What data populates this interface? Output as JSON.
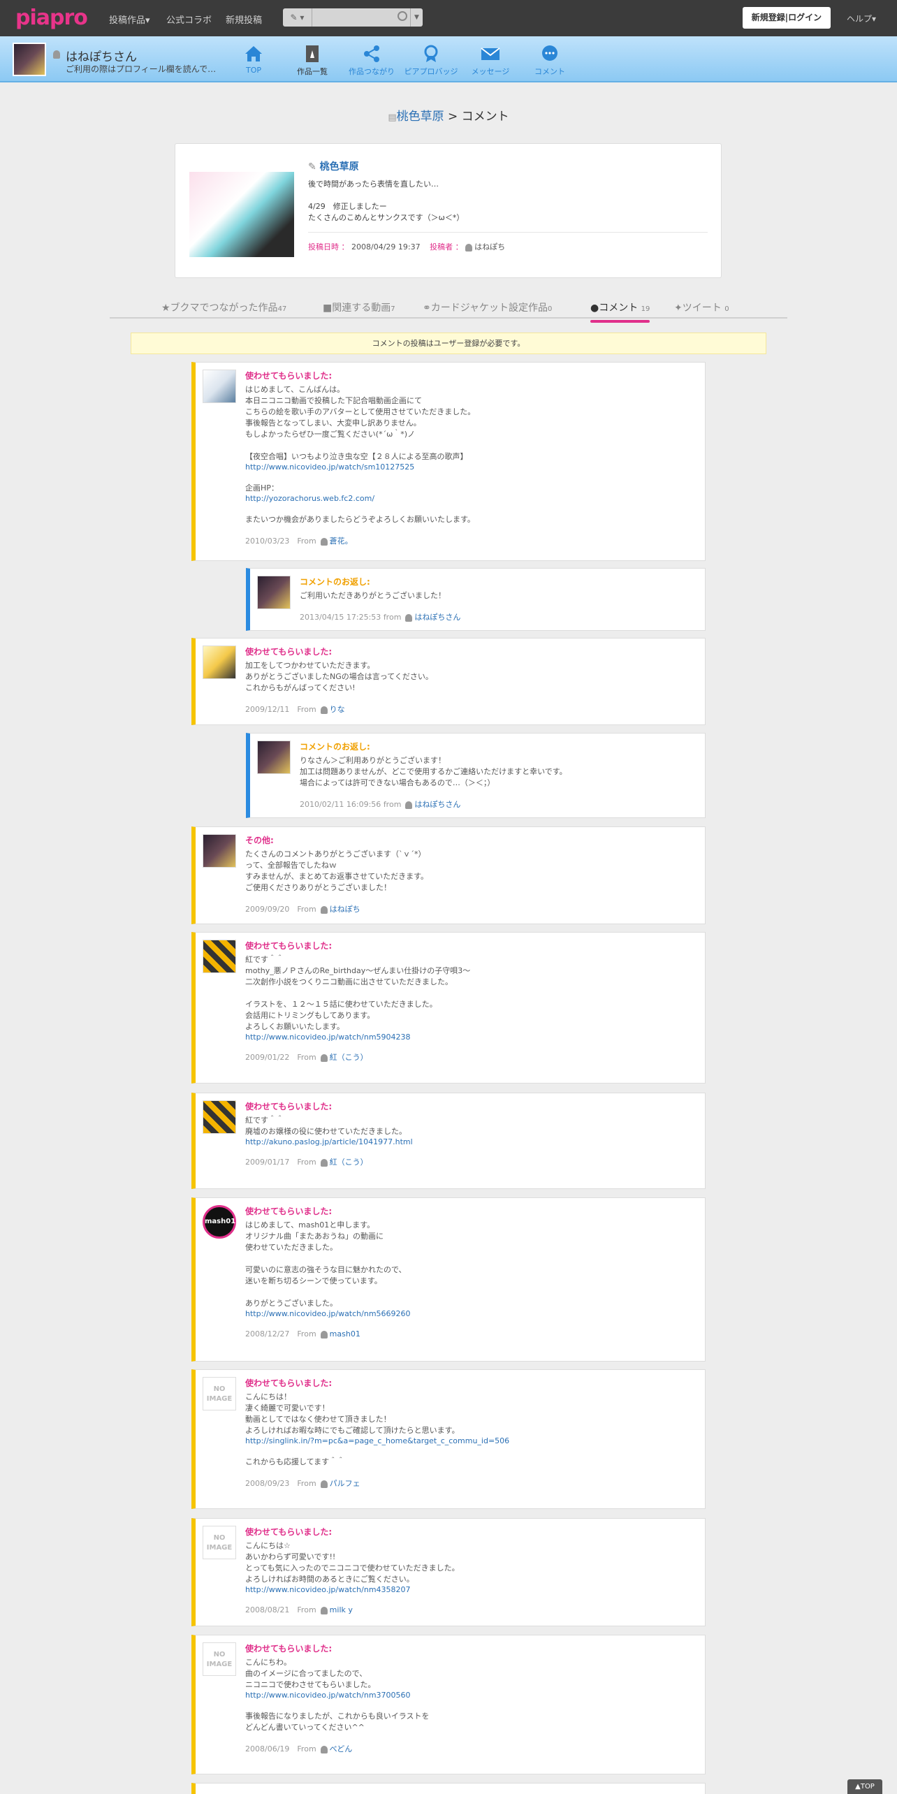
{
  "header": {
    "logo": "piapro",
    "nav": [
      "投稿作品▾",
      "公式コラボ",
      "新規投稿"
    ],
    "search": {
      "type": "✎ ▾",
      "placeholder": ""
    },
    "login": "新規登録|ログイン",
    "help": "ヘルプ▾"
  },
  "userbar": {
    "name": "はねぽちさん",
    "note": "ご利用の際はプロフィール欄を読んで…",
    "items": [
      {
        "label": "TOP",
        "icon": "home-icon"
      },
      {
        "label": "作品一覧",
        "icon": "works-icon"
      },
      {
        "label": "作品つながり",
        "icon": "share-icon"
      },
      {
        "label": "ピアプロバッジ",
        "icon": "badge-icon"
      },
      {
        "label": "メッセージ",
        "icon": "mail-icon"
      },
      {
        "label": "コメント",
        "icon": "comment-icon"
      }
    ]
  },
  "breadcrumb": {
    "work": "桃色草原",
    "sep": ">",
    "page": "コメント"
  },
  "work": {
    "title": "桃色草原",
    "desc": "後で時間があったら表情を直したい…\n\n4/29　修正しましたー\nたくさんのこめんとサンクスです（＞ω＜*）",
    "date_label": "投稿日時",
    "date": "2008/04/29 19:37",
    "author_label": "投稿者",
    "author": "はねぽち"
  },
  "tabs": [
    {
      "label": "ブクマでつながった作品",
      "count": "47"
    },
    {
      "label": "関連する動画",
      "count": "7"
    },
    {
      "label": "カードジャケット設定作品",
      "count": "0"
    },
    {
      "label": "コメント",
      "count": "19"
    },
    {
      "label": "ツイート",
      "count": "0"
    }
  ],
  "notice": "コメントの投稿はユーザー登録が必要です。",
  "comments": [
    {
      "title": "使わせてもらいました:",
      "text": "はじめまして、こんばんは。\n本日ニコニコ動画で投稿した下記合唱動画企画にて\nこちらの絵を歌い手のアバターとして使用させていただきました。\n事後報告となってしまい、大変申し訳ありません。\nもしよかったらぜひ一度ご覧ください(*´ω｀*)ノ\n\n【夜空合唱】いつもより泣き虫な空【２８人による至高の歌声】",
      "link": "http://www.nicovideo.jp/watch/sm10127525",
      "text2": "\n企画HP：",
      "link2": "http://yozorachorus.web.fc2.com/",
      "text3": "\nまたいつか機会がありましたらどうぞよろしくお願いいたします。",
      "date": "2010/03/23",
      "from": "From",
      "user": "蒼花。"
    },
    {
      "title": "コメントのお返し:",
      "text": "ご利用いただきありがとうございました！",
      "date": "2013/04/15 17:25:53",
      "from": "from",
      "user": "はねぽちさん"
    },
    {
      "title": "使わせてもらいました:",
      "text": "加工をしてつかわせていただきます。\nありがとうございましたNGの場合は言ってください。\nこれからもがんばってください!",
      "date": "2009/12/11",
      "from": "From",
      "user": "りな"
    },
    {
      "title": "コメントのお返し:",
      "text": "りなさん＞ご利用ありがとうございます！\n加工は問題ありませんが、どこで使用するかご連絡いただけますと幸いです。\n場合によっては許可できない場合もあるので…（＞＜；）",
      "date": "2010/02/11 16:09:56",
      "from": "from",
      "user": "はねぽちさん"
    },
    {
      "title": "その他:",
      "text": "たくさんのコメントありがとうございます（`ｖ´*）\nって、全部報告でしたねｗ\nすみませんが、まとめてお返事させていただきます。\nご使用くださりありがとうございました！",
      "date": "2009/09/20",
      "from": "From",
      "user": "はねぽち"
    },
    {
      "title": "使わせてもらいました:",
      "text": "紅です＾＾\nmothy_悪ノＰさんのRe_birthday～ぜんまい仕掛けの子守唄3～\n二次創作小説をつくりニコ動画に出させていただきました。\n\nイラストを、１２～１５話に使わせていただきました。\n会話用にトリミングもしてあります。\nよろしくお願いいたします。\n",
      "link": "http://www.nicovideo.jp/watch/nm5904238",
      "date": "2009/01/22",
      "from": "From",
      "user": "紅（こう）"
    },
    {
      "title": "使わせてもらいました:",
      "text": "紅です＾＾\n廃墟のお嬢様の役に使わせていただきました。\n",
      "link": "http://akuno.paslog.jp/article/1041977.html",
      "date": "2009/01/17",
      "from": "From",
      "user": "紅（こう）"
    },
    {
      "title": "使わせてもらいました:",
      "text": "はじめまして、mash01と申します。\nオリジナル曲「またあおうね」の動画に\n使わせていただきました。\n\n可愛いのに意志の強そうな目に魅かれたので、\n迷いを断ち切るシーンで使っています。\n\nありがとうございました。\n",
      "link": "http://www.nicovideo.jp/watch/nm5669260",
      "date": "2008/12/27",
      "from": "From",
      "user": "mash01",
      "avatar_text": "mash01"
    },
    {
      "title": "使わせてもらいました:",
      "text": "こんにちは！\n凄く綺麗で可愛いです！\n動画としてではなく使わせて頂きました！\nよろしければお暇な時にでもご確認して頂けたらと思います。\n",
      "link": "http://singlink.in/?m=pc&a=page_c_home&target_c_commu_id=506",
      "text2": "\nこれからも応援してます＾＾",
      "date": "2008/09/23",
      "from": "From",
      "user": "パルフェ",
      "noimg": "NO IMAGE"
    },
    {
      "title": "使わせてもらいました:",
      "text": "こんにちは☆\nあいかわらず可愛いです!!\nとっても気に入ったのでニコニコで使わせていただきました。\nよろしければお時間のあるときにご覧ください。",
      "link": "http://www.nicovideo.jp/watch/nm4358207",
      "date": "2008/08/21",
      "from": "From",
      "user": "milk y",
      "noimg": "NO IMAGE"
    },
    {
      "title": "使わせてもらいました:",
      "text": "こんにちわ。\n曲のイメージに合ってましたので、\nニコニコで使わさせてもらいました。\n",
      "link": "http://www.nicovideo.jp/watch/nm3700560",
      "text2": "\n事後報告になりましたが、これからも良いイラストを\nどんどん書いていってください^^",
      "date": "2008/06/19",
      "from": "From",
      "user": "べどん",
      "noimg": "NO IMAGE"
    }
  ],
  "totop": "▲TOP"
}
